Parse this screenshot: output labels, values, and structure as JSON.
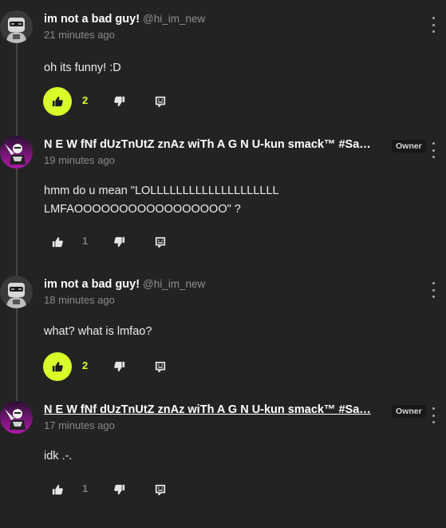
{
  "comments": [
    {
      "author": "im not a bad guy!",
      "handle": "@hi_im_new",
      "time": "21 minutes ago",
      "text": "oh its funny! :D",
      "likes": "2",
      "liked": true,
      "owner": false,
      "avatar": "robot-avatar"
    },
    {
      "author": "N E W fNf dUzTnUtZ znAz wiTh A G N U-kun smack™ #Sa…",
      "handle": "",
      "time": "19 minutes ago",
      "text": "hmm do u mean \"LOLLLLLLLLLLLLLLLLLLLL\nLMFAOOOOOOOOOOOOOOOOO\" ?",
      "likes": "1",
      "liked": false,
      "owner": true,
      "owner_label": "Owner",
      "avatar": "purple-character-avatar"
    },
    {
      "author": "im not a bad guy!",
      "handle": "@hi_im_new",
      "time": "18 minutes ago",
      "text": "what? what is lmfao?",
      "likes": "2",
      "liked": true,
      "owner": false,
      "avatar": "robot-avatar"
    },
    {
      "author": "N E W fNf dUzTnUtZ znAz wiTh A G N U-kun smack™ #Sa…",
      "handle": "",
      "time": "17 minutes ago",
      "text": "idk .-.",
      "likes": "1",
      "liked": false,
      "owner": true,
      "owner_label": "Owner",
      "avatar": "purple-character-avatar"
    }
  ],
  "colors": {
    "background": "#232323",
    "accent": "#d9ff2a",
    "muted": "#8a8a8a"
  },
  "icons": {
    "like": "thumbs-up-icon",
    "dislike": "thumbs-down-icon",
    "reply": "reply-icon",
    "more": "more-vertical-icon"
  }
}
